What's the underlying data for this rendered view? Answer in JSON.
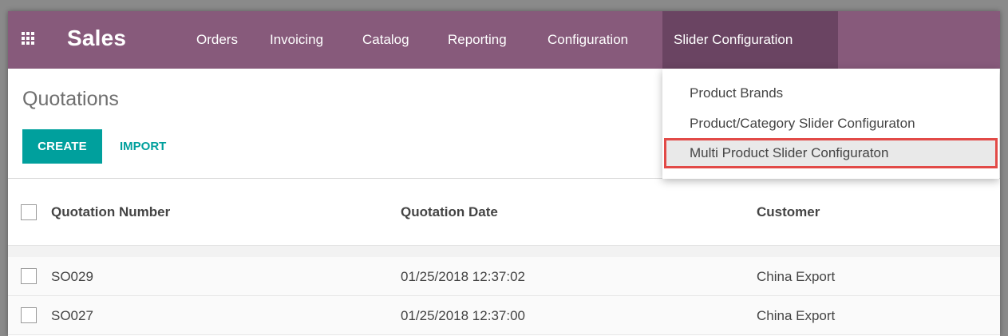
{
  "app": {
    "name": "Sales"
  },
  "icons": {
    "apps": "grid-apps-icon"
  },
  "colors": {
    "navbar": "#875a7b",
    "navbar_active": "#6a4462",
    "primary_button": "#00a09d",
    "highlight_border": "#e24a47"
  },
  "menu": {
    "items": [
      {
        "label": "Orders"
      },
      {
        "label": "Invoicing"
      },
      {
        "label": "Catalog"
      },
      {
        "label": "Reporting"
      },
      {
        "label": "Configuration"
      },
      {
        "label": "Slider Configuration",
        "active": true
      }
    ]
  },
  "dropdown": {
    "items": [
      {
        "label": "Product Brands"
      },
      {
        "label": "Product/Category Slider Configuraton"
      },
      {
        "label": "Multi Product Slider Configuraton",
        "highlighted": true
      }
    ]
  },
  "control_panel": {
    "title": "Quotations",
    "create_label": "CREATE",
    "import_label": "IMPORT"
  },
  "table": {
    "columns": [
      "Quotation Number",
      "Quotation Date",
      "Customer"
    ],
    "rows": [
      {
        "number": "SO029",
        "date": "01/25/2018 12:37:02",
        "customer": "China Export"
      },
      {
        "number": "SO027",
        "date": "01/25/2018 12:37:00",
        "customer": "China Export"
      }
    ]
  }
}
